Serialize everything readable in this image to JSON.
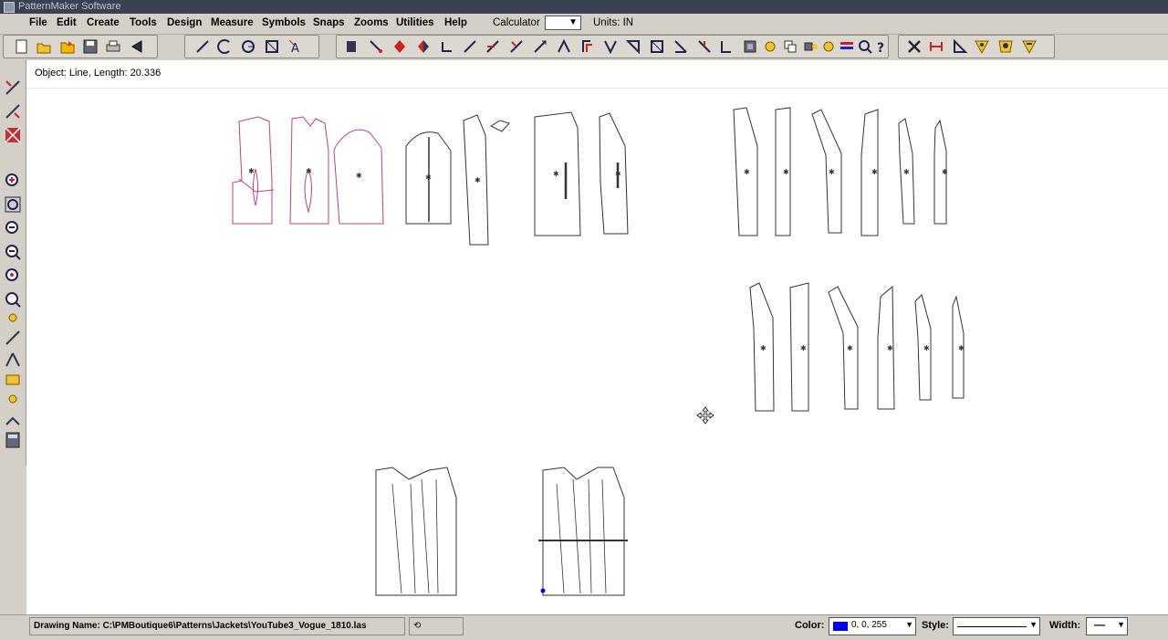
{
  "window": {
    "title": "PatternMaker Software"
  },
  "menu": {
    "items": [
      "File",
      "Edit",
      "Create",
      "Tools",
      "Design",
      "Measure",
      "Symbols",
      "Snaps",
      "Zooms",
      "Utilities",
      "Help"
    ],
    "calculator_label": "Calculator",
    "units_label": "Units: IN"
  },
  "status": {
    "object_info": "Object: Line, Length: 20.336"
  },
  "bottom": {
    "drawing_name": "Drawing Name: C:\\PMBoutique6\\Patterns\\Jackets\\YouTube3_Vogue_1810.las",
    "color_label": "Color:",
    "color_value": "0, 0, 255",
    "color_hex": "#0000ff",
    "style_label": "Style:",
    "width_label": "Width:",
    "width_value": "—"
  },
  "colors": {
    "pattern_pink": "#c0407a",
    "pattern_line": "#333333",
    "canvas": "#ffffff",
    "chrome": "#d4d0c8"
  },
  "toolbar_icons": [
    "new-icon",
    "open-icon",
    "folder-icon",
    "save-icon",
    "print-icon",
    "back-icon",
    "line-icon",
    "arc-icon",
    "circle-icon",
    "rectangle-icon",
    "text-icon",
    "select-icon",
    "move-icon",
    "mirror-icon",
    "flip-icon",
    "rotate-icon",
    "slash-icon",
    "extend-icon",
    "trim-icon",
    "break-icon",
    "join-icon",
    "offset-icon",
    "dart-icon",
    "pleat-icon",
    "notch-icon",
    "angle-icon",
    "grade-icon",
    "symbol-icon",
    "duplicate-icon",
    "group-icon",
    "ungroup-icon",
    "layer-icon",
    "help-icon",
    "delete-icon",
    "measure-icon",
    "triangle-icon",
    "shield-icon",
    "shield2-icon",
    "shield3-icon"
  ],
  "left_icons": [
    "seam-tool-icon",
    "cut-tool-icon",
    "pattern-icon",
    "zoom-in-icon",
    "zoom-window-icon",
    "zoom-all-icon",
    "zoom-out-icon",
    "zoom-previous-icon",
    "pan-icon",
    "zoom-realtime-icon",
    "node-icon",
    "arrow-icon",
    "measure-icon",
    "tape-icon",
    "light-icon",
    "calculator-icon"
  ]
}
